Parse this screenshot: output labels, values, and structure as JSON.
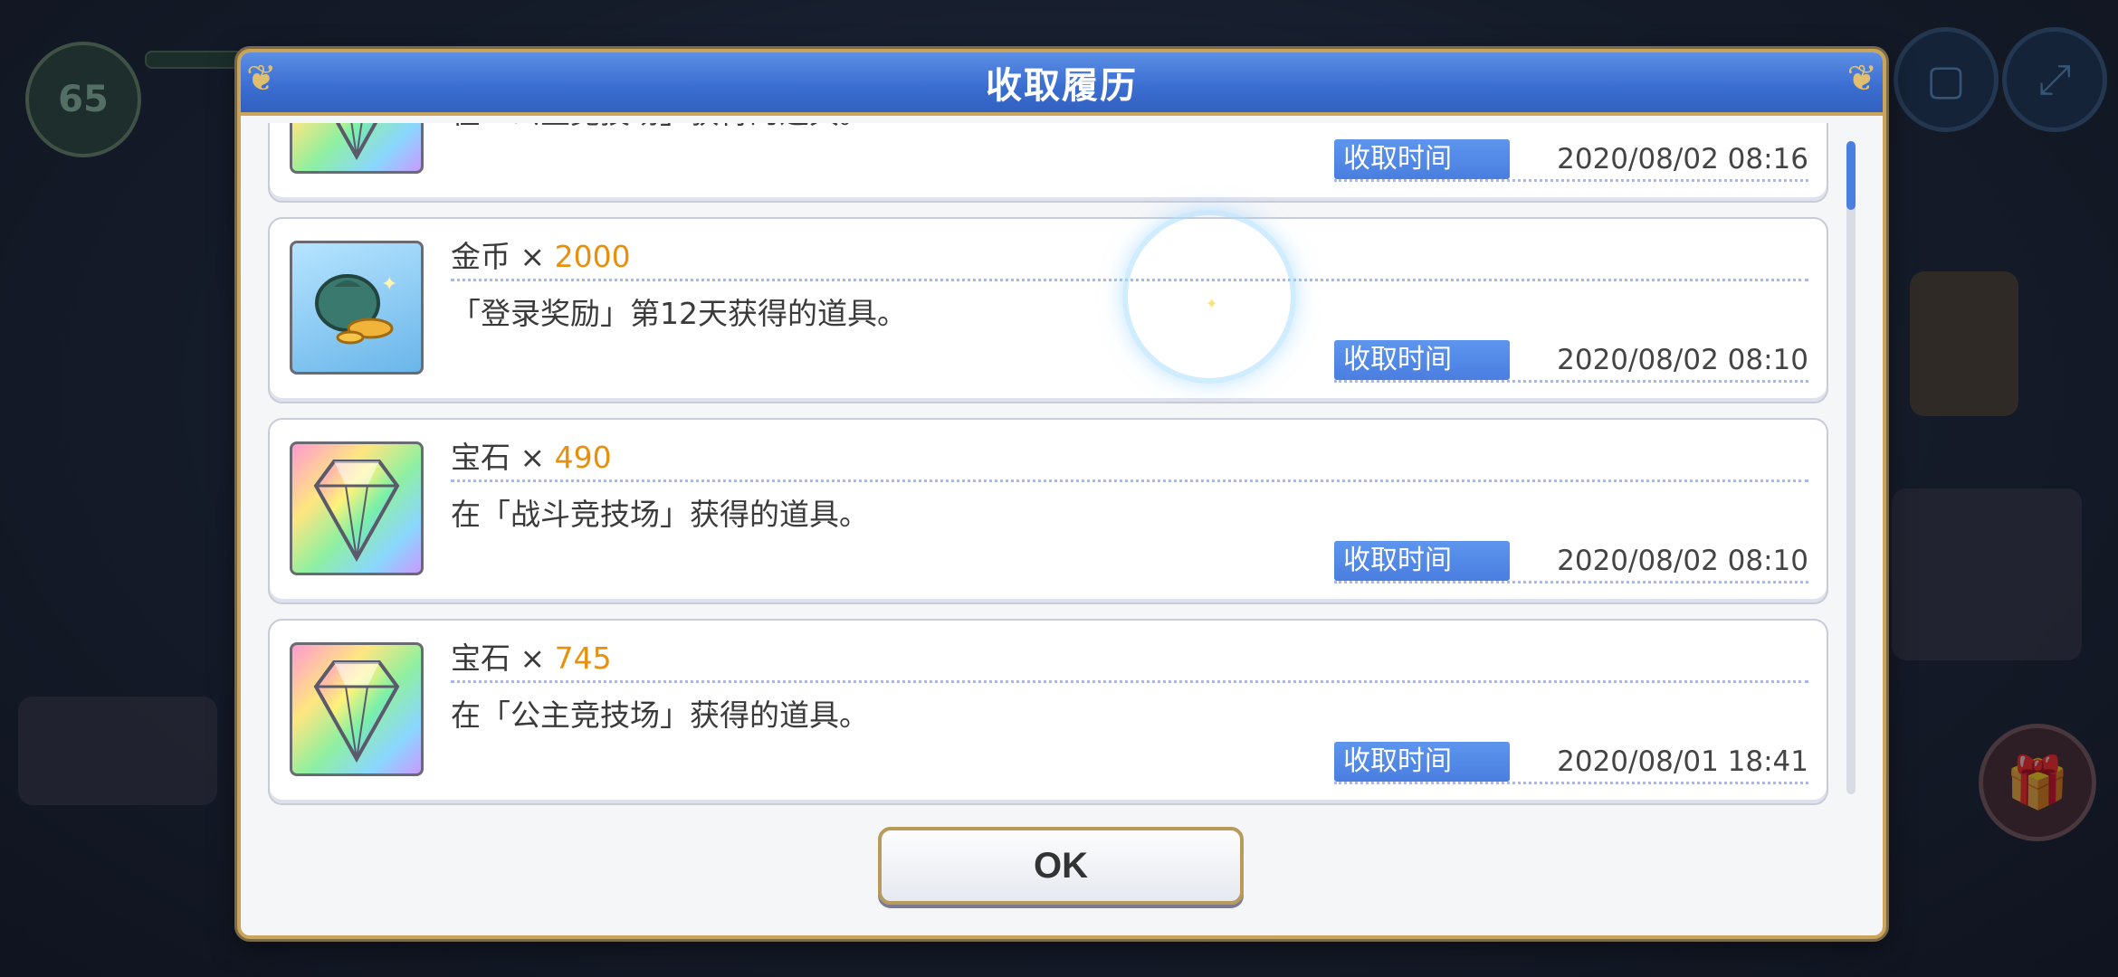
{
  "dialog": {
    "title": "收取履历",
    "ok_label": "OK"
  },
  "time_label": "收取时间",
  "items": [
    {
      "name": "",
      "qty": "",
      "desc": "在「公主竞技场」获得的道具。",
      "time": "2020/08/02 08:16",
      "icon": "gem-icon"
    },
    {
      "name": "金币 × ",
      "qty": "2000",
      "desc": "「登录奖励」第12天获得的道具。",
      "time": "2020/08/02 08:10",
      "icon": "coin-bag-icon"
    },
    {
      "name": "宝石 × ",
      "qty": "490",
      "desc": "在「战斗竞技场」获得的道具。",
      "time": "2020/08/02 08:10",
      "icon": "gem-icon"
    },
    {
      "name": "宝石 × ",
      "qty": "745",
      "desc": "在「公主竞技场」获得的道具。",
      "time": "2020/08/01 18:41",
      "icon": "gem-icon"
    }
  ],
  "background": {
    "level": "65"
  },
  "colors": {
    "accent": "#4a7ee0",
    "qty": "#e8900c",
    "frame": "#c9a45a"
  }
}
